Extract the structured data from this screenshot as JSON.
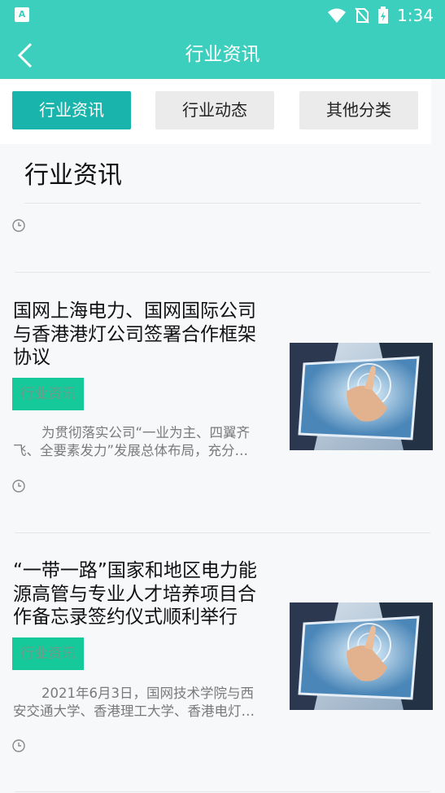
{
  "status_bar": {
    "time": "1:34",
    "app_icon": "A"
  },
  "header": {
    "title": "行业资讯",
    "back_icon": "chevron-left-icon"
  },
  "tabs": [
    {
      "label": "行业资讯",
      "active": true
    },
    {
      "label": "行业动态",
      "active": false
    },
    {
      "label": "其他分类",
      "active": false
    }
  ],
  "section": {
    "title": "行业资讯"
  },
  "articles": [
    {
      "title_lines": [
        "国网上海电力、国网国际公司",
        "与香港港灯公司签署合作框架",
        "协议"
      ],
      "tag": "行业资讯",
      "summary_lines": [
        "为贯彻落实公司“一业为主、四翼齐",
        "飞、全要素发力”发展总体布局，充分…"
      ]
    },
    {
      "title_lines": [
        "“一带一路”国家和地区电力能",
        "源高管与专业人才培养项目合",
        "作备忘录签约仪式顺利举行"
      ],
      "tag": "行业资讯",
      "summary_lines": [
        "2021年6月3日，国网技术学院与西",
        "安交通大学、香港理工大学、香港电灯…"
      ]
    }
  ],
  "colors": {
    "header": "#3ccfbd",
    "tab_active": "#19b4ac",
    "tag": "#15c99a"
  }
}
